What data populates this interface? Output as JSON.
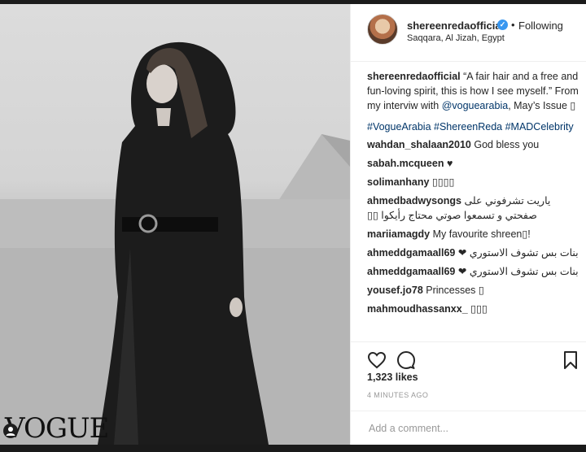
{
  "post": {
    "watermark": "VOGUE",
    "username": "shereenredaofficial",
    "follow_status": "Following",
    "location": "Saqqara, Al Jizah, Egypt",
    "caption": {
      "username": "shereenredaofficial",
      "text_before": " “A fair hair and a free and fun-loving spirit, this is how I see myself.” From my interviw with ",
      "mention": "@voguearabia",
      "text_after": ", May’s Issue ▯",
      "hashtags": "#VogueArabia #ShereenReda #MADCelebrity"
    },
    "comments": [
      {
        "user": "wahdan_shalaan2010",
        "text": "God bless you"
      },
      {
        "user": "sabah.mcqueen",
        "text": "♥"
      },
      {
        "user": "solimanhany",
        "text": "▯▯▯▯"
      },
      {
        "user": "ahmedbadwysongs",
        "text": "ياريت تشرفوني على صفحتي و تسمعوا صوتي محتاج رأيكوا ▯▯"
      },
      {
        "user": "mariiamagdy",
        "text": "My favourite shreen▯!"
      },
      {
        "user": "ahmeddgamaall69",
        "text": "بنات بس تشوف الاستوري ❤"
      },
      {
        "user": "ahmeddgamaall69",
        "text": "بنات بس تشوف الاستوري ❤"
      },
      {
        "user": "yousef.jo78",
        "text": "Princesses ▯"
      },
      {
        "user": "mahmoudhassanxx_",
        "text": "▯▯▯"
      }
    ],
    "likes": "1,323 likes",
    "time": "4 MINUTES AGO",
    "add_comment_placeholder": "Add a comment..."
  },
  "icons": {
    "verified": "verified-badge-icon",
    "like": "heart-icon",
    "comment": "comment-bubble-icon",
    "save": "bookmark-icon",
    "tagged": "user-tag-icon"
  },
  "colors": {
    "link": "#003569",
    "verified": "#3897f0",
    "muted": "#999999"
  }
}
